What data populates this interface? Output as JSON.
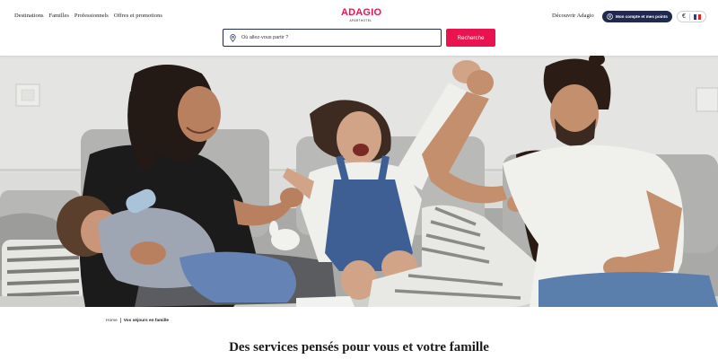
{
  "header": {
    "nav": [
      "Destinations",
      "Familles",
      "Professionnels",
      "Offres et promotions"
    ],
    "logo": {
      "brand": "ADAGIO",
      "tagline": "APARTHOTEL"
    },
    "discover_label": "Découvrir Adagio",
    "account_label": "Mon compte et mes points",
    "currency": "€",
    "language_flag": "fr-flag-icon"
  },
  "search": {
    "placeholder": "Où allez-vous partir ?",
    "value": "",
    "button_label": "Recherche"
  },
  "hero": {
    "image": "family-on-sofa-photo"
  },
  "breadcrumb": {
    "items": [
      "Home",
      "Vos séjours en famille"
    ]
  },
  "section": {
    "title_regular": "Des services pensés pour vous et ",
    "title_bold": "votre famille"
  },
  "colors": {
    "brand": "#e8134f",
    "navy": "#1f2a4e"
  }
}
